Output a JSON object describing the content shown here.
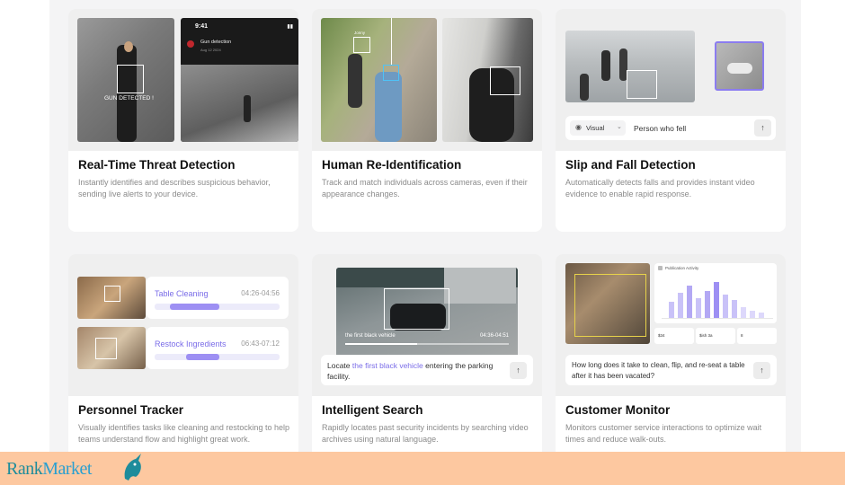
{
  "cards": [
    {
      "title": "Real-Time Threat Detection",
      "description": "Instantly identifies and describes suspicious behavior, sending live alerts to your device.",
      "overlay_label": "GUN DETECTED !",
      "phone": {
        "time": "9:41",
        "alert": "Gun detection",
        "date": "Aug 12 2024"
      }
    },
    {
      "title": "Human Re-Identification",
      "description": "Track and match individuals across cameras, even if their appearance changes.",
      "person_tag": "Jonny"
    },
    {
      "title": "Slip and Fall Detection",
      "description": "Automatically detects falls and provides instant video evidence to enable rapid response.",
      "search": {
        "mode": "Visual",
        "query": "Person who fell"
      }
    },
    {
      "title": "Personnel Tracker",
      "description": "Visually identifies tasks like cleaning and restocking to help teams understand flow and highlight great work.",
      "tasks": [
        {
          "label": "Table Cleaning",
          "time": "04:26-04:56",
          "progress_start": 0.12,
          "progress_end": 0.52
        },
        {
          "label": "Restock Ingredients",
          "time": "06:43-07:12",
          "progress_start": 0.25,
          "progress_end": 0.52
        }
      ]
    },
    {
      "title": "Intelligent Search",
      "description": "Rapidly locates past security incidents by searching video archives using natural language.",
      "clip_label": "the first black vehicle",
      "clip_time": "04:36-04:51",
      "query_prefix": "Locate ",
      "query_highlight": "the first black vehicle",
      "query_suffix": " entering the parking facility."
    },
    {
      "title": "Customer Monitor",
      "description": "Monitors customer service interactions to optimize wait times and reduce walk-outs.",
      "chart_title": "Publication Activity",
      "stats": [
        "$34",
        "$ish 3a",
        "8"
      ],
      "question": "How long does it take to clean, flip, and re-seat a table after it has been vacated?"
    }
  ],
  "brand": {
    "part1": "Rank",
    "part2": "Market"
  },
  "colors": {
    "accent": "#8b7cf0",
    "footer": "#fdc8a0",
    "brand": "#1e8c9b"
  }
}
